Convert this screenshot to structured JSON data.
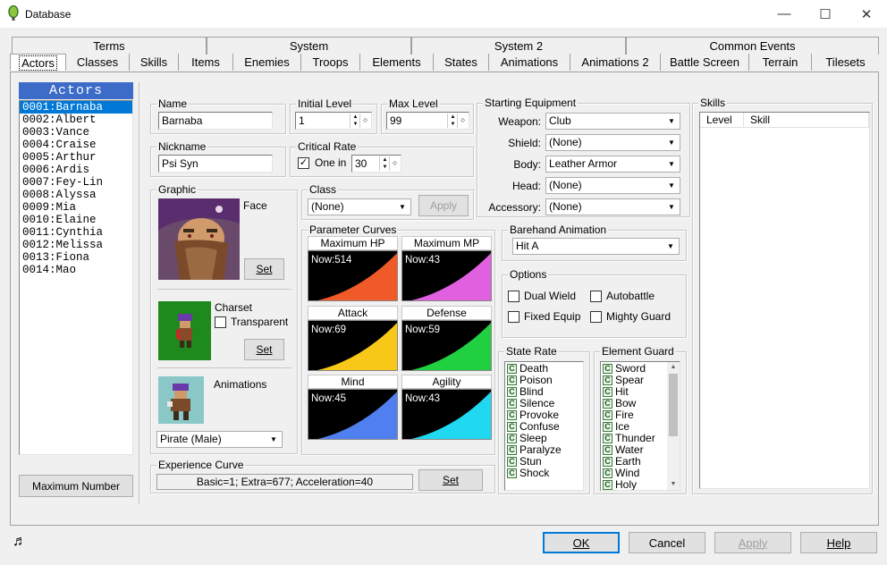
{
  "window": {
    "title": "Database",
    "min": "—",
    "max": "☐",
    "close": "✕"
  },
  "tabs_top": [
    "Terms",
    "System",
    "System 2",
    "Common Events"
  ],
  "tabs_bottom": [
    "Actors",
    "Classes",
    "Skills",
    "Items",
    "Enemies",
    "Troops",
    "Elements",
    "States",
    "Animations",
    "Animations 2",
    "Battle Screen",
    "Terrain",
    "Tilesets"
  ],
  "actors": {
    "header": "Actors",
    "items": [
      "0001:Barnaba",
      "0002:Albert",
      "0003:Vance",
      "0004:Craise",
      "0005:Arthur",
      "0006:Ardis",
      "0007:Fey-Lin",
      "0008:Alyssa",
      "0009:Mia",
      "0010:Elaine",
      "0011:Cynthia",
      "0012:Melissa",
      "0013:Fiona",
      "0014:Mao"
    ],
    "selected_index": 0,
    "max_button": "Maximum Number"
  },
  "name": {
    "label": "Name",
    "value": "Barnaba"
  },
  "nickname": {
    "label": "Nickname",
    "value": "Psi Syn"
  },
  "initial_level": {
    "label": "Initial Level",
    "value": "1"
  },
  "max_level": {
    "label": "Max Level",
    "value": "99"
  },
  "critical_rate": {
    "label": "Critical Rate",
    "checkbox_label": "One in",
    "checked": true,
    "value": "30"
  },
  "graphic": {
    "label": "Graphic",
    "face_label": "Face",
    "face_set": "Set",
    "charset_label": "Charset",
    "transparent_label": "Transparent",
    "charset_set": "Set",
    "animations_label": "Animations",
    "animation_value": "Pirate (Male)"
  },
  "class": {
    "label": "Class",
    "value": "(None)",
    "apply": "Apply"
  },
  "parameter_curves": {
    "label": "Parameter Curves",
    "curves": [
      {
        "title": "Maximum HP",
        "now": "Now:514",
        "color": "#f05a28"
      },
      {
        "title": "Maximum MP",
        "now": "Now:43",
        "color": "#e060e0"
      },
      {
        "title": "Attack",
        "now": "Now:69",
        "color": "#f8c818"
      },
      {
        "title": "Defense",
        "now": "Now:59",
        "color": "#20d040"
      },
      {
        "title": "Mind",
        "now": "Now:45",
        "color": "#5080f0"
      },
      {
        "title": "Agility",
        "now": "Now:43",
        "color": "#20d8f0"
      }
    ]
  },
  "experience_curve": {
    "label": "Experience Curve",
    "value": "Basic=1; Extra=677; Acceleration=40",
    "set": "Set"
  },
  "starting_equipment": {
    "label": "Starting Equipment",
    "slots": [
      {
        "label": "Weapon:",
        "value": "Club"
      },
      {
        "label": "Shield:",
        "value": "(None)"
      },
      {
        "label": "Body:",
        "value": "Leather Armor"
      },
      {
        "label": "Head:",
        "value": "(None)"
      },
      {
        "label": "Accessory:",
        "value": "(None)"
      }
    ]
  },
  "barehand": {
    "label": "Barehand Animation",
    "value": "Hit A"
  },
  "options": {
    "label": "Options",
    "dual_wield": "Dual Wield",
    "autobattle": "Autobattle",
    "fixed_equip": "Fixed Equip",
    "mighty_guard": "Mighty Guard"
  },
  "state_rate": {
    "label": "State Rate",
    "rank": "C",
    "items": [
      "Death",
      "Poison",
      "Blind",
      "Silence",
      "Provoke",
      "Confuse",
      "Sleep",
      "Paralyze",
      "Stun",
      "Shock"
    ]
  },
  "element_guard": {
    "label": "Element Guard",
    "rank": "C",
    "items": [
      "Sword",
      "Spear",
      "Hit",
      "Bow",
      "Fire",
      "Ice",
      "Thunder",
      "Water",
      "Earth",
      "Wind",
      "Holy"
    ]
  },
  "skills": {
    "label": "Skills",
    "col_level": "Level",
    "col_skill": "Skill"
  },
  "buttons": {
    "ok": "OK",
    "cancel": "Cancel",
    "apply": "Apply",
    "help": "Help"
  },
  "icons": {
    "music": "♬",
    "up": "▲",
    "down": "▼",
    "mid": "◇"
  }
}
